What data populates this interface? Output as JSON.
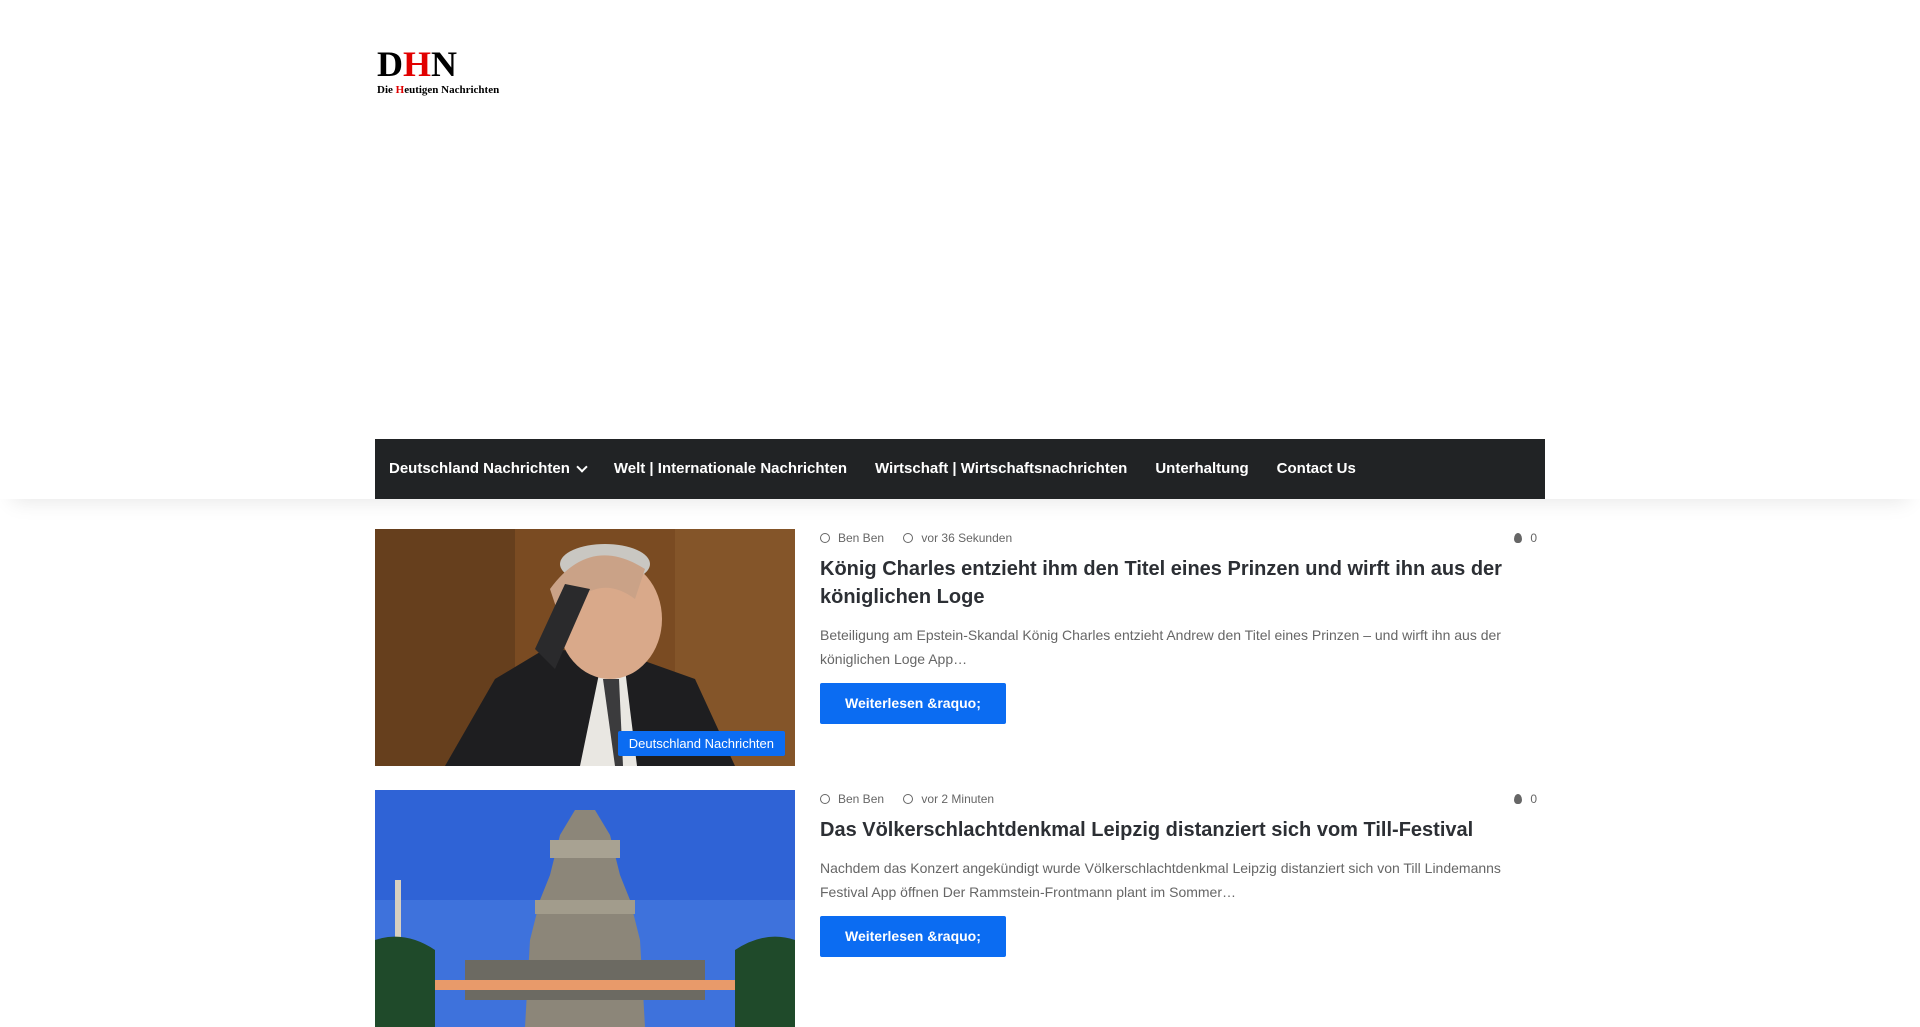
{
  "logo": {
    "main_pre": "D",
    "main_hl": "H",
    "main_post": "N",
    "tag_pre": "Die ",
    "tag_hl": "H",
    "tag_post": "eutigen Nachrichten"
  },
  "nav": {
    "items": [
      {
        "label": "Deutschland Nachrichten",
        "has_dropdown": true
      },
      {
        "label": "Welt | Internationale Nachrichten"
      },
      {
        "label": "Wirtschaft | Wirtschaftsnachrichten"
      },
      {
        "label": "Unterhaltung"
      },
      {
        "label": "Contact Us"
      }
    ]
  },
  "posts": [
    {
      "author": "Ben Ben",
      "time": "vor 36 Sekunden",
      "views": "0",
      "title": "König Charles entzieht ihm den Titel eines Prinzen und wirft ihn aus der königlichen Loge",
      "excerpt": "Beteiligung am Epstein-Skandal König Charles entzieht Andrew den Titel eines Prinzen – und wirft ihn aus der königlichen Loge App…",
      "button": "Weiterlesen &raquo;",
      "category": "Deutschland Nachrichten"
    },
    {
      "author": "Ben Ben",
      "time": "vor 2 Minuten",
      "views": "0",
      "title": "Das Völkerschlachtdenkmal Leipzig distanziert sich vom Till-Festival",
      "excerpt": "Nachdem das Konzert angekündigt wurde Völkerschlachtdenkmal Leipzig distanziert sich von Till Lindemanns Festival App öffnen Der Rammstein-Frontmann plant im Sommer…",
      "button": "Weiterlesen &raquo;"
    }
  ],
  "colors": {
    "nav_bg": "#212325",
    "accent": "#0b6cf2",
    "logo_red": "#e10000"
  }
}
